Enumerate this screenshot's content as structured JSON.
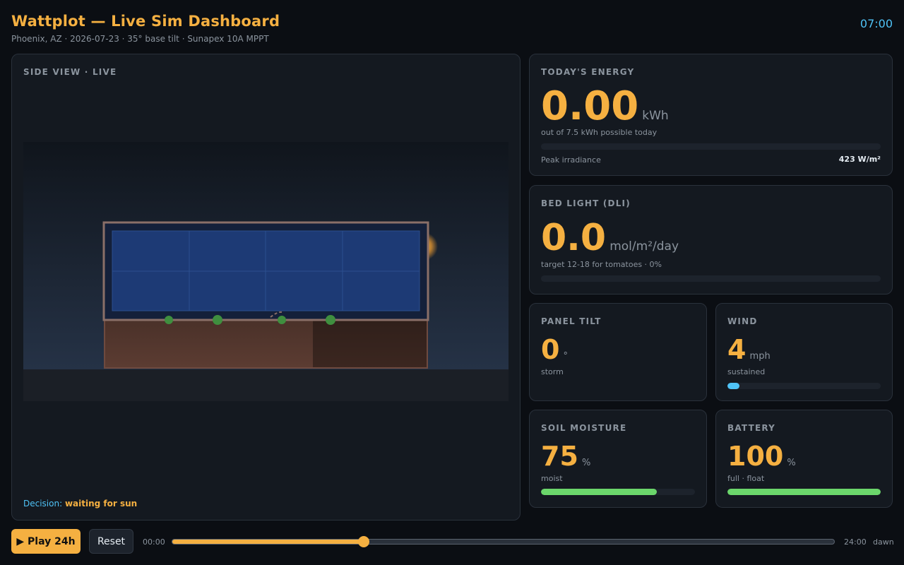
{
  "header": {
    "title": "Wattplot — Live Sim Dashboard",
    "subtitle": "Phoenix, AZ · 2026-07-23 · 35° base tilt · Sunapex 10A MPPT",
    "clock": "07:00"
  },
  "scene": {
    "label": "SIDE VIEW · LIVE",
    "decision_label": "Decision:",
    "decision_value": "waiting for sun"
  },
  "energy": {
    "label": "TODAY'S ENERGY",
    "value": "0.00",
    "unit": "kWh",
    "caption": "out of 7.5 kWh possible today",
    "progress": 0,
    "peak_label": "Peak irradiance",
    "peak_value": "423 W/m²"
  },
  "dli": {
    "label": "BED LIGHT (DLI)",
    "value": "0.0",
    "unit": "mol/m²/day",
    "caption": "target 12-18 for tomatoes · 0%",
    "progress": 0
  },
  "tilt": {
    "label": "PANEL TILT",
    "value": "0",
    "unit": "°",
    "caption": "storm"
  },
  "wind": {
    "label": "WIND",
    "value": "4",
    "unit": "mph",
    "caption": "sustained",
    "progress": 0.08
  },
  "soil": {
    "label": "SOIL MOISTURE",
    "value": "75",
    "unit": "%",
    "caption": "moist",
    "progress": 0.75
  },
  "battery": {
    "label": "BATTERY",
    "value": "100",
    "unit": "%",
    "caption": "full · float",
    "progress": 1.0
  },
  "controls": {
    "play_label": "▶ Play 24h",
    "reset_label": "Reset",
    "time_start": "00:00",
    "time_end": "24:00",
    "phase": "dawn",
    "timeline_position": 0.29
  },
  "colors": {
    "accent": "#f5b041",
    "info": "#4fc3f7",
    "good": "#6bd66b",
    "panel": "#1d3a75"
  }
}
